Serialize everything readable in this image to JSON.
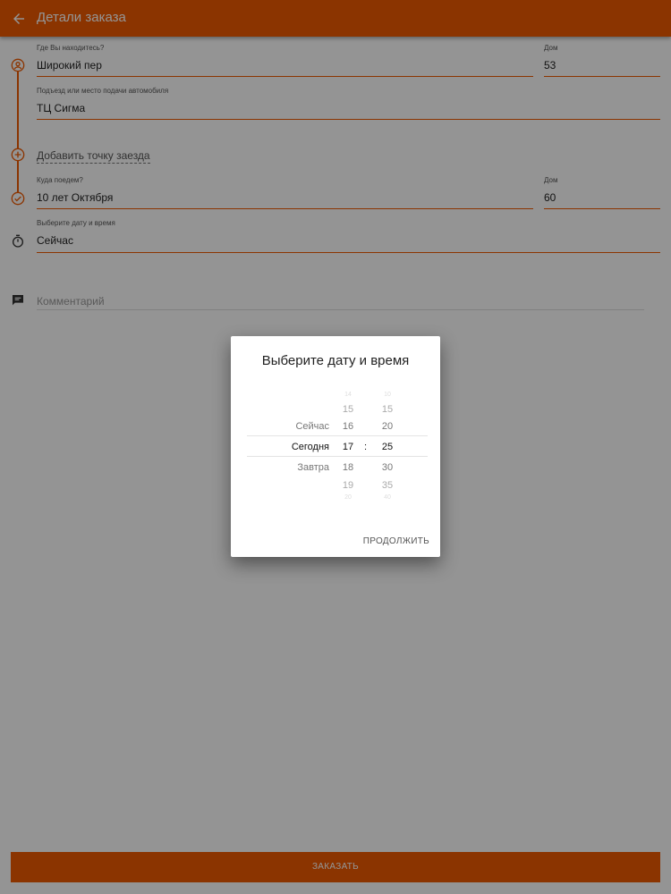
{
  "header": {
    "title": "Детали заказа"
  },
  "form": {
    "from_label": "Где Вы находитесь?",
    "from_value": "Широкий пер",
    "from_house_label": "Дом",
    "from_house_value": "53",
    "entrance_label": "Подъезд или место подачи автомобиля",
    "entrance_value": "ТЦ Сигма",
    "add_stop": "Добавить точку заезда",
    "to_label": "Куда поедем?",
    "to_value": "10 лет Октября",
    "to_house_label": "Дом",
    "to_house_value": "60",
    "datetime_label": "Выберите дату и время",
    "datetime_value": "Сейчас",
    "comment_placeholder": "Комментарий"
  },
  "order_button": "ЗАКАЗАТЬ",
  "dialog": {
    "title": "Выберите дату и время",
    "days": {
      "prev": "Сейчас",
      "selected": "Сегодня",
      "next": "Завтра"
    },
    "hours": {
      "far_prev": "14",
      "prev2": "15",
      "prev": "16",
      "selected": "17",
      "next": "18",
      "next2": "19",
      "far_next": "20"
    },
    "minutes": {
      "far_prev": "10",
      "prev2": "15",
      "prev": "20",
      "selected": "25",
      "next": "30",
      "next2": "35",
      "far_next": "40"
    },
    "separator": ":",
    "continue": "ПРОДОЛЖИТЬ"
  },
  "colors": {
    "accent": "#f05a00"
  },
  "icons": [
    "arrow-back-icon",
    "person-pin-icon",
    "add-circle-icon",
    "check-circle-icon",
    "timer-icon",
    "comment-icon"
  ]
}
